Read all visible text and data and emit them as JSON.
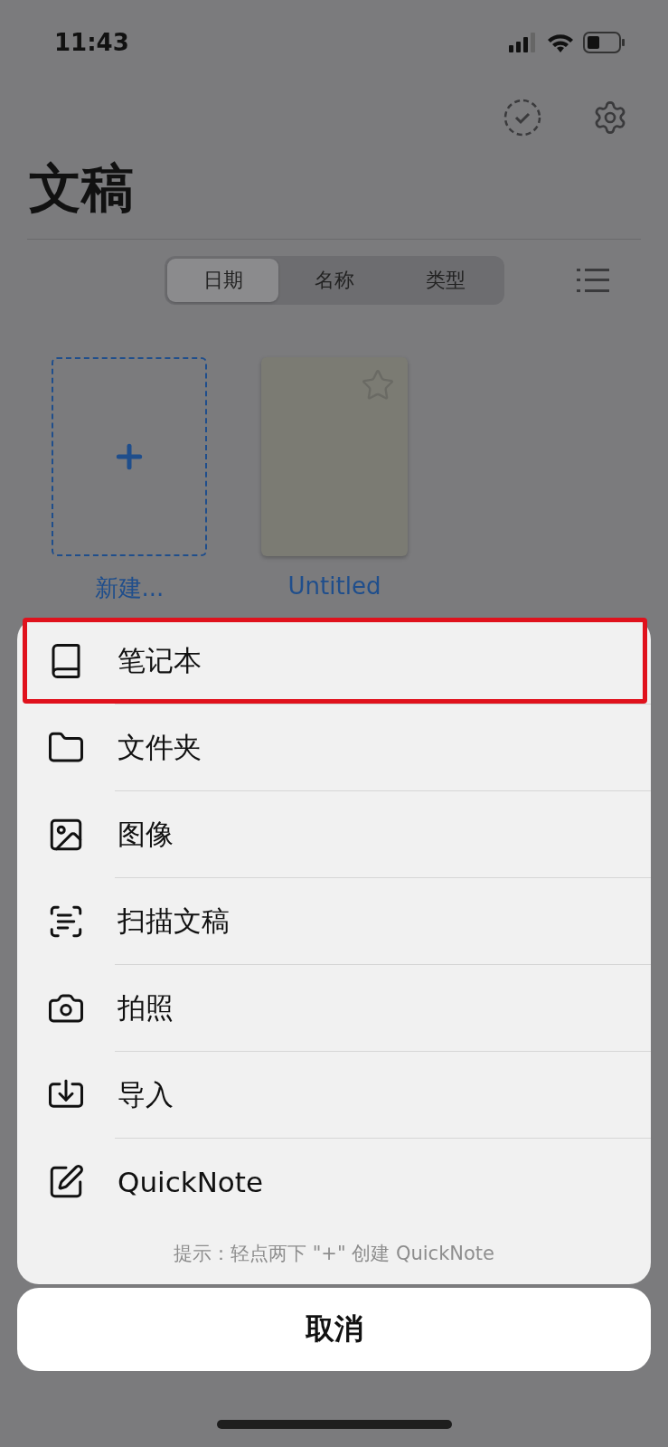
{
  "status_bar": {
    "time": "11:43"
  },
  "header": {
    "title": "文稿"
  },
  "sort_control": {
    "segments": [
      {
        "label": "日期",
        "selected": true
      },
      {
        "label": "名称",
        "selected": false
      },
      {
        "label": "类型",
        "selected": false
      }
    ]
  },
  "documents": [
    {
      "kind": "new",
      "label": "新建..."
    },
    {
      "kind": "notebook",
      "label": "Untitled",
      "starred": false
    }
  ],
  "action_sheet": {
    "items": [
      {
        "label": "笔记本",
        "highlighted": true
      },
      {
        "label": "文件夹",
        "highlighted": false
      },
      {
        "label": "图像",
        "highlighted": false
      },
      {
        "label": "扫描文稿",
        "highlighted": false
      },
      {
        "label": "拍照",
        "highlighted": false
      },
      {
        "label": "导入",
        "highlighted": false
      },
      {
        "label": "QuickNote",
        "highlighted": false
      }
    ],
    "hint": "提示：轻点两下 \"+\" 创建 QuickNote",
    "cancel": "取消"
  }
}
